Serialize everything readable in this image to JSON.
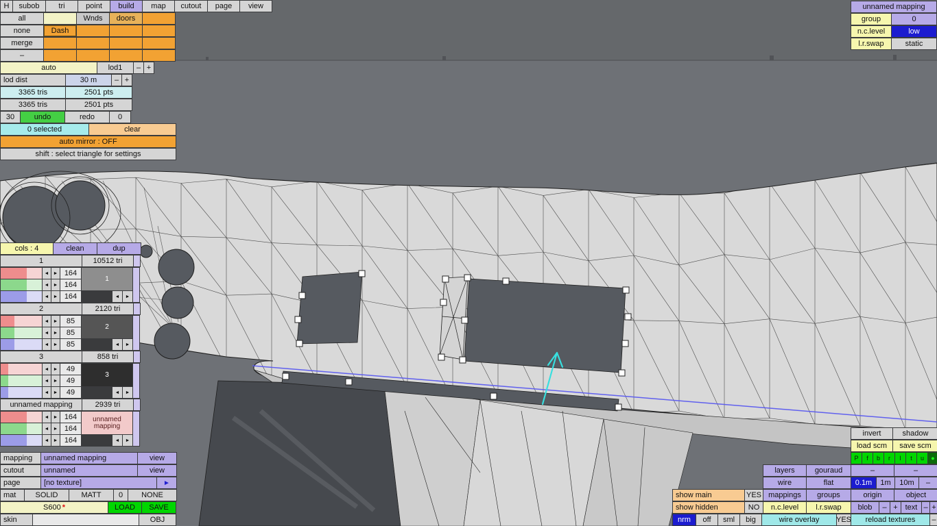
{
  "viewport": {
    "sky": "#65686b",
    "ground": "#6e7176",
    "model_light": "#d9d9d9",
    "model_mid": "#c4c4c4",
    "model_dark_opening": "#565a60",
    "selection_handle": "#ffffff",
    "move_arrow": "#38dfdf",
    "guide_line": "#5a5af0"
  },
  "topbar": {
    "items": [
      "H",
      "subob",
      "tri",
      "point",
      "build",
      "map",
      "cutout",
      "page",
      "view"
    ],
    "active_item": "build"
  },
  "subobject_grid": {
    "row_labels": [
      "all",
      "none",
      "merge",
      "–"
    ],
    "cells": [
      [
        "",
        "Wnds",
        "doors",
        ""
      ],
      [
        "Dash",
        "",
        "",
        ""
      ],
      [
        "",
        "",
        "",
        ""
      ],
      [
        "",
        "",
        "",
        ""
      ]
    ]
  },
  "lod_panel": {
    "auto": "auto",
    "lod": "lod1",
    "minus": "–",
    "plus": "+",
    "dist_label": "lod dist",
    "dist_value": "30 m",
    "stats": [
      {
        "tris": "3365 tris",
        "pts": "2501 pts"
      },
      {
        "tris": "3365 tris",
        "pts": "2501 pts"
      }
    ],
    "undo_count": "30",
    "undo": "undo",
    "redo": "redo",
    "redo_count": "0",
    "selected": "0 selected",
    "clear": "clear",
    "auto_mirror": "auto mirror : OFF",
    "hint": "shift : select triangle for settings"
  },
  "mapping_panel": {
    "title": "unnamed mapping",
    "group_label": "group",
    "group_value": "0",
    "nc_label": "n.c.level",
    "nc_value": "low",
    "lr_label": "l.r.swap",
    "lr_value": "static"
  },
  "cols_panel": {
    "header": "cols : 4",
    "clean": "clean",
    "dup": "dup",
    "arrow_left": "◄",
    "arrow_right": "►",
    "groups": [
      {
        "name": "1",
        "tri": "10512 tri",
        "r": "164",
        "g": "164",
        "b": "164",
        "box_label": "1",
        "box_color": "#8e8e8e",
        "box_text_color": "#ffffff"
      },
      {
        "name": "2",
        "tri": "2120 tri",
        "r": "85",
        "g": "85",
        "b": "85",
        "box_label": "2",
        "box_color": "#555555",
        "box_text_color": "#ffffff"
      },
      {
        "name": "3",
        "tri": "858 tri",
        "r": "49",
        "g": "49",
        "b": "49",
        "box_label": "3",
        "box_color": "#2e2e2e",
        "box_text_color": "#ffffff"
      },
      {
        "name": "unnamed mapping",
        "tri": "2939 tri",
        "r": "164",
        "g": "164",
        "b": "164",
        "box_label": "unnamed mapping",
        "box_color": "#f2caca",
        "box_text_color": "#5a2020"
      }
    ]
  },
  "object_panel": {
    "mapping_label": "mapping",
    "mapping_value": "unnamed mapping",
    "mapping_view": "view",
    "cutout_label": "cutout",
    "cutout_value": "unnamed",
    "cutout_view": "view",
    "page_label": "page",
    "page_value": "[no texture]",
    "page_arrow": "►",
    "mat_label": "mat",
    "mat_values": [
      "SOLID",
      "MATT",
      "0",
      "NONE"
    ],
    "model_name": "S600",
    "modified_star": "*",
    "load": "LOAD",
    "save": "SAVE",
    "skin_label": "skin",
    "skin_value": "",
    "obj": "OBJ"
  },
  "view_panel": {
    "invert": "invert",
    "shadow": "shadow",
    "load_scm": "load scm",
    "save_scm": "save scm",
    "proj_buttons": [
      "P",
      "f",
      "b",
      "r",
      "l",
      "t",
      "u"
    ],
    "proj_dot": "●",
    "layers": "layers",
    "gouraud": "gouraud",
    "layers_dash": "–",
    "gouraud_dash": "–",
    "wire": "wire",
    "flat": "flat",
    "grid_01": "0.1m",
    "grid_1": "1m",
    "grid_10": "10m",
    "grid_dash": "–",
    "show_main": "show main",
    "show_main_value": "YES",
    "mappings": "mappings",
    "groups": "groups",
    "origin": "origin",
    "object": "object",
    "show_hidden": "show hidden",
    "show_hidden_value": "NO",
    "nc_level": "n.c.level",
    "lr_swap": "l.r.swap",
    "blob": "blob",
    "blob_minus": "–",
    "blob_plus": "+",
    "text": "text",
    "text_minus": "–",
    "text_plus": "+",
    "nrm": "nrm",
    "off": "off",
    "sml": "sml",
    "big": "big",
    "wire_overlay": "wire overlay",
    "wire_overlay_value": "YES",
    "reload_textures": "reload textures",
    "end_dash": "–"
  }
}
